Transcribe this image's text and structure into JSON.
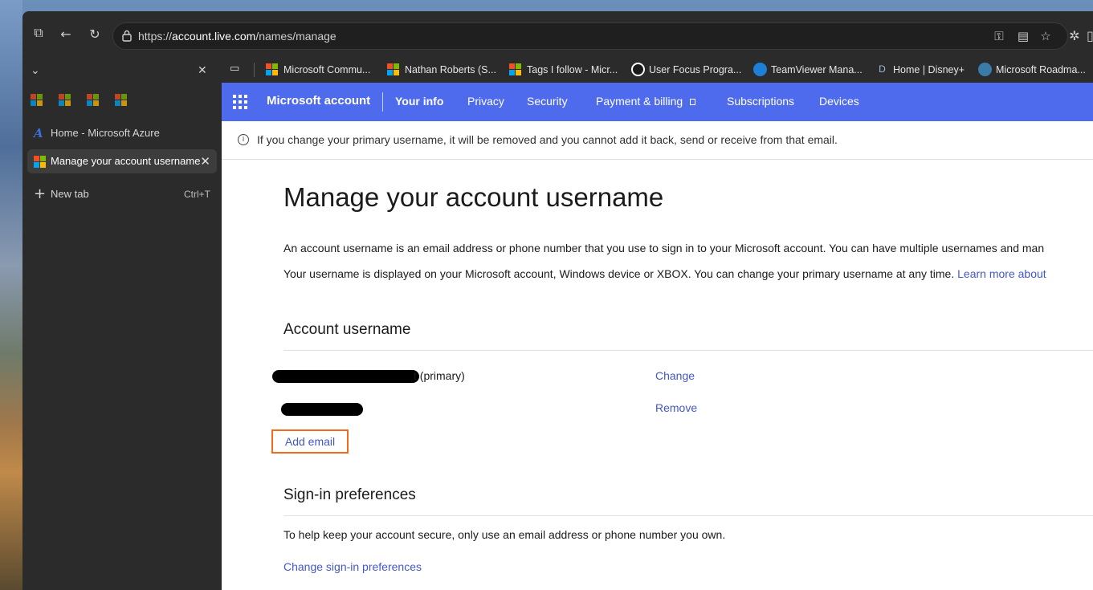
{
  "browser": {
    "url_prefix": "https://",
    "url_host": "account.live.com",
    "url_path": "/names/manage"
  },
  "sidebar": {
    "tabs": [
      {
        "label": "Home - Microsoft Azure"
      },
      {
        "label": "Manage your account username"
      },
      {
        "label": "New tab",
        "shortcut": "Ctrl+T"
      }
    ]
  },
  "favorites": [
    {
      "label": "Microsoft Commu..."
    },
    {
      "label": "Nathan Roberts (S..."
    },
    {
      "label": "Tags I follow - Micr..."
    },
    {
      "label": "User Focus Progra..."
    },
    {
      "label": "TeamViewer Mana..."
    },
    {
      "label": "Home | Disney+"
    },
    {
      "label": "Microsoft Roadma..."
    }
  ],
  "msnav": {
    "brand": "Microsoft account",
    "items": [
      {
        "label": "Your info"
      },
      {
        "label": "Privacy"
      },
      {
        "label": "Security"
      },
      {
        "label": "Payment & billing"
      },
      {
        "label": "Subscriptions"
      },
      {
        "label": "Devices"
      }
    ]
  },
  "info_banner": "If you change your primary username, it will be removed and you cannot add it back, send or receive from that email.",
  "page": {
    "title": "Manage your account username",
    "para1": "An account username is an email address or phone number that you use to sign in to your Microsoft account. You can have multiple usernames and man",
    "para2": "Your username is displayed on your Microsoft account, Windows device or XBOX. You can change your primary username at any time.",
    "learn_more": "Learn more about"
  },
  "account_username": {
    "title": "Account username",
    "primary_suffix": "t (primary)",
    "change_label": "Change",
    "remove_label": "Remove",
    "add_email_label": "Add email"
  },
  "signin_prefs": {
    "title": "Sign-in preferences",
    "text": "To help keep your account secure, only use an email address or phone number you own.",
    "link": "Change sign-in preferences"
  },
  "colors": {
    "nav_bg": "#4f6bed",
    "link": "#4258c7",
    "highlight": "#f26a1b",
    "browser_bg": "#2b2b2b"
  }
}
